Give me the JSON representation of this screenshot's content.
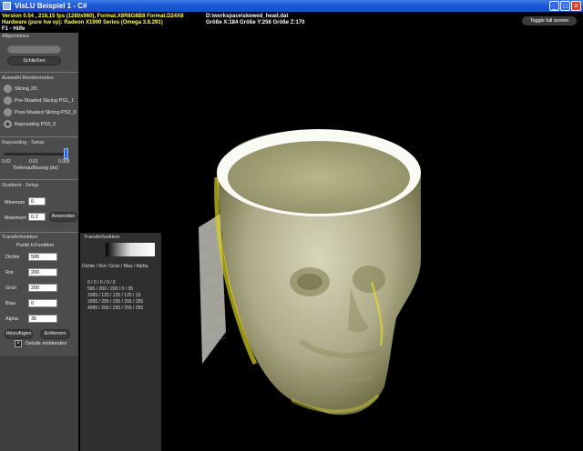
{
  "window": {
    "title": "VisLU Beispiel 1 - C#"
  },
  "hud": {
    "line1": "Version 0.54 , 218,15 fps (1280x960), Format.X8R8G8B8 Format.D24X8",
    "line2": "Hardware (pure hw vp): Radeon X1900 Series (Omega 3.8.291)",
    "line3": "F1 - Hilfe",
    "file": "D:\\workspace\\skewed_head.dat",
    "size": "Größe X:184 Größe Y:256 Größe Z:170"
  },
  "toggle_fullscreen": "Toggle full screen",
  "allgemeines": {
    "title": "Allgemeines",
    "close_button": "Schließen"
  },
  "render": {
    "title": "Auswahl Rendermodus",
    "options": [
      "Slicing 2D",
      "Pre-Shaded Slicing PS1_1",
      "Post-Shaded Slicing PS2_0",
      "Raycasting PS3_0"
    ]
  },
  "raycasting": {
    "title": "Raycasting - Setup",
    "tick_min": "0.02",
    "tick_mid": "0.01",
    "tick_max": "0.005",
    "label": "Tiefenauflösung (dx)",
    "slider_fraction": 0.95
  },
  "gradient": {
    "title": "Gradient - Setup",
    "min_label": "Minimum",
    "min_value": "0",
    "max_label": "Maximum",
    "max_value": "0.2",
    "apply": "Anwenden"
  },
  "transfer": {
    "title": "Transferfunktion",
    "subtitle": "Punkt h.Funktion",
    "fields": [
      {
        "label": "Dichte",
        "value": "595"
      },
      {
        "label": "Rot",
        "value": "200"
      },
      {
        "label": "Grün",
        "value": "200"
      },
      {
        "label": "Blau",
        "value": "0"
      },
      {
        "label": "Alpha",
        "value": "35"
      }
    ],
    "add": "Hinzufügen",
    "remove": "Entfernen",
    "details": "Details einblenden"
  },
  "tf_panel": {
    "title": "Transferfunktion",
    "header": "Dichte / Rot / Grün / Blau / Alpha",
    "rows": [
      "0 / 0 / 0 / 0 / 0",
      "595 / 200 / 200 / 0 / 35",
      "1095 / 125 / 125 / 125 / 15",
      "2095 / 255 / 255 / 255 / 255",
      "4095 / 255 / 255 / 255 / 255"
    ]
  }
}
